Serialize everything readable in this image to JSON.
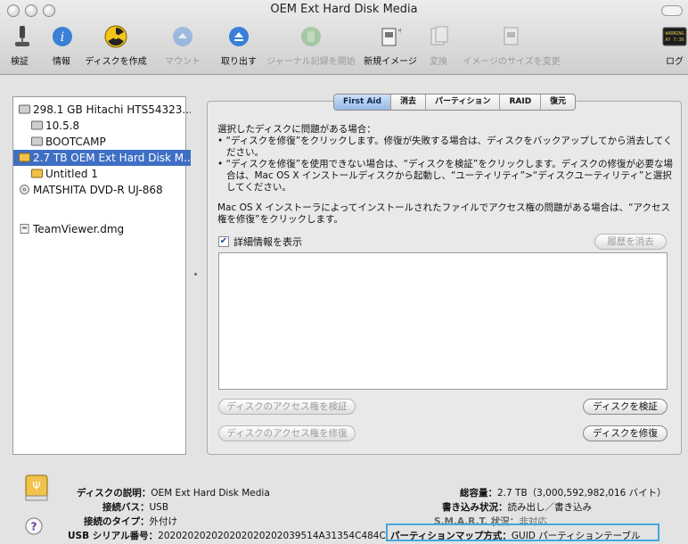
{
  "window": {
    "title": "OEM Ext Hard Disk Media"
  },
  "toolbar": {
    "verify": "検証",
    "info": "情報",
    "burn": "ディスクを作成",
    "mount": "マウント",
    "eject": "取り出す",
    "journal": "ジャーナル記録を開始",
    "new_image": "新規イメージ",
    "convert": "変換",
    "resize": "イメージのサイズを変更",
    "log": "ログ",
    "log_icon_text": "WARNING\nAY 7:36"
  },
  "sidebar": {
    "items": [
      {
        "label": "298.1 GB Hitachi HTS54323..."
      },
      {
        "label": "10.5.8"
      },
      {
        "label": "BOOTCAMP"
      },
      {
        "label": "2.7 TB OEM Ext Hard Disk M..."
      },
      {
        "label": "Untitled 1"
      },
      {
        "label": "MATSHITA DVD-R UJ-868"
      },
      {
        "label": "TeamViewer.dmg"
      }
    ]
  },
  "tabs": [
    "First Aid",
    "消去",
    "パーティション",
    "RAID",
    "復元"
  ],
  "firstaid": {
    "line1": "選択したディスクに問題がある場合：",
    "bullet1": "• “ディスクを修復”をクリックします。修復が失敗する場合は、ディスクをバックアップしてから消去してください。",
    "bullet2": "• “ディスクを修復”を使用できない場合は、“ディスクを検証”をクリックします。ディスクの修復が必要な場合は、Mac OS X インストールディスクから起動し、“ユーティリティ”>“ディスクユーティリティ”と選択してください。",
    "para2": "Mac OS X インストーラによってインストールされたファイルでアクセス権の問題がある場合は、“アクセス権を修復”をクリックします。",
    "show_details": "詳細情報を表示",
    "clear_history": "履歴を消去",
    "verify_permissions": "ディスクのアクセス権を検証",
    "repair_permissions": "ディスクのアクセス権を修復",
    "verify_disk": "ディスクを検証",
    "repair_disk": "ディスクを修復"
  },
  "info": {
    "desc_k": "ディスクの説明：",
    "desc_v": "OEM Ext Hard Disk Media",
    "bus_k": "接続バス：",
    "bus_v": "USB",
    "type_k": "接続のタイプ：",
    "type_v": "外付け",
    "serial_k": "USB シリアル番号：",
    "serial_v": "202020202020202020202039514A31354C484C",
    "cap_k": "総容量：",
    "cap_v": "2.7 TB（3,000,592,982,016 バイト）",
    "write_k": "書き込み状況：",
    "write_v": "読み出し／書き込み",
    "smart_k": "S.M.A.R.T. 状況：",
    "smart_v": "非対応",
    "pmap_k": "パーティションマップ方式：",
    "pmap_v": "GUID パーティションテーブル"
  },
  "colors": {
    "selection": "#3f6fc4",
    "highlight": "#43a8dc"
  }
}
